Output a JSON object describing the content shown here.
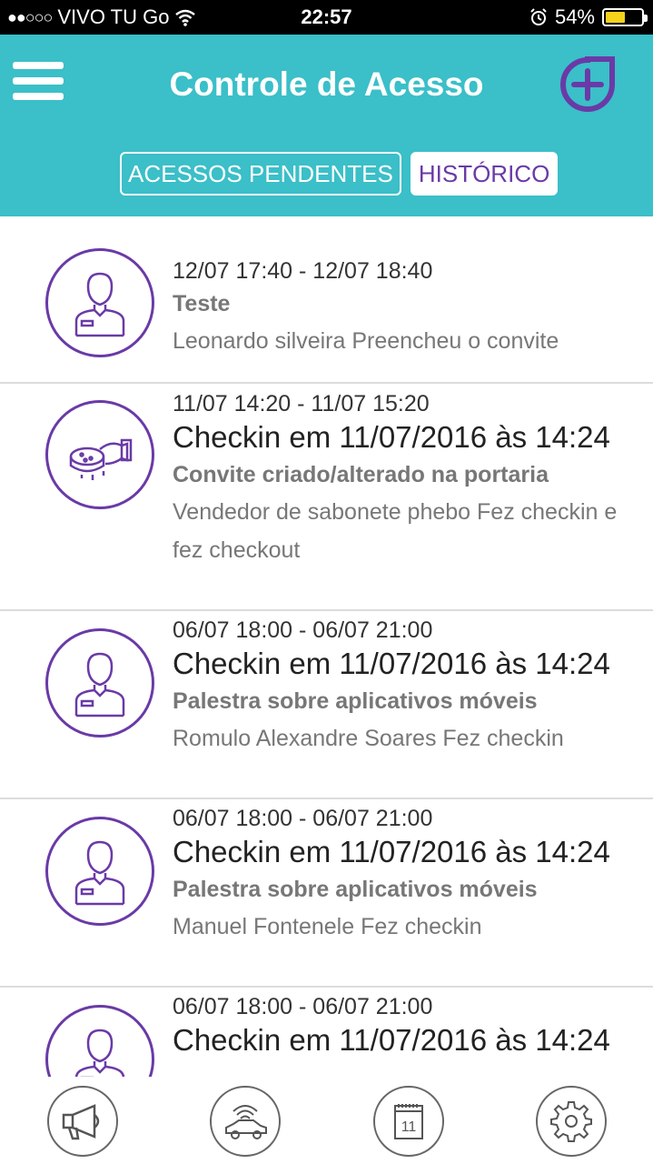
{
  "status_bar": {
    "signal": "●●○○○",
    "carrier": "VIVO TU Go",
    "time": "22:57",
    "battery_percent": "54%",
    "battery_level": 0.54
  },
  "header": {
    "title": "Controle de Acesso",
    "tabs": [
      {
        "label": "ACESSOS PENDENTES",
        "active": false
      },
      {
        "label": "HISTÓRICO",
        "active": true
      }
    ]
  },
  "history": [
    {
      "icon": "person-icon",
      "date": "12/07 17:40 - 12/07 18:40",
      "checkin": "",
      "title": "Teste",
      "description": "Leonardo silveira Preencheu o convite"
    },
    {
      "icon": "soap-icon",
      "date": "11/07 14:20 - 11/07 15:20",
      "checkin": "Checkin em 11/07/2016 às 14:24",
      "title": "Convite criado/alterado na portaria",
      "description": "Vendedor de sabonete phebo Fez checkin e fez checkout"
    },
    {
      "icon": "person-icon",
      "date": "06/07 18:00 - 06/07 21:00",
      "checkin": "Checkin em 11/07/2016 às 14:24",
      "title": "Palestra sobre aplicativos móveis",
      "description": "Romulo Alexandre Soares Fez checkin"
    },
    {
      "icon": "person-icon",
      "date": "06/07 18:00 - 06/07 21:00",
      "checkin": "Checkin em 11/07/2016 às 14:24",
      "title": "Palestra sobre aplicativos móveis",
      "description": "Manuel Fontenele Fez checkin"
    },
    {
      "icon": "person-icon",
      "date": "06/07 18:00 - 06/07 21:00",
      "checkin": "Checkin em 11/07/2016 às 14:24",
      "title": "",
      "description": ""
    }
  ],
  "bottom_nav": {
    "items": [
      {
        "icon": "megaphone-icon"
      },
      {
        "icon": "car-signal-icon"
      },
      {
        "icon": "calendar-icon",
        "label": "11"
      },
      {
        "icon": "gear-icon"
      }
    ]
  },
  "colors": {
    "header": "#3bbfc8",
    "accent": "#6a3aa7"
  }
}
